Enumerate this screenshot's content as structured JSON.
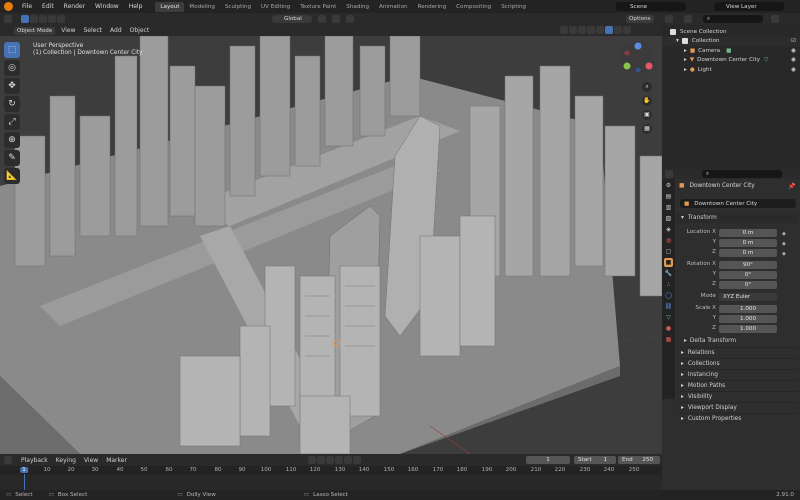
{
  "topbar": {
    "menus": [
      "File",
      "Edit",
      "Render",
      "Window",
      "Help"
    ],
    "workspaces": [
      "Layout",
      "Modeling",
      "Sculpting",
      "UV Editing",
      "Texture Paint",
      "Shading",
      "Animation",
      "Rendering",
      "Compositing",
      "Scripting"
    ],
    "active_workspace": "Layout",
    "scene": "Scene",
    "view_layer": "View Layer"
  },
  "viewport_header": {
    "mode": "Object Mode",
    "menus": [
      "View",
      "Select",
      "Add",
      "Object"
    ],
    "orientation": "Global",
    "options": "Options"
  },
  "viewport": {
    "title": "User Perspective",
    "subtitle": "(1) Collection | Downtown Center City"
  },
  "outliner": {
    "search_placeholder": "",
    "root": "Scene Collection",
    "collection": "Collection",
    "items": [
      {
        "name": "Camera",
        "icon": "camera-icon",
        "color": "#e09a52"
      },
      {
        "name": "Downtown Center City",
        "icon": "mesh-icon",
        "color": "#e09a52"
      },
      {
        "name": "Light",
        "icon": "light-icon",
        "color": "#e09a52"
      }
    ]
  },
  "properties": {
    "object_name": "Downtown Center City",
    "object_field": "Downtown Center City",
    "transform_label": "Transform",
    "location": {
      "label": "Location X",
      "x": "0 m",
      "y": "0 m",
      "z": "0 m"
    },
    "rotation": {
      "label": "Rotation X",
      "x": "90°",
      "y": "0°",
      "z": "0°"
    },
    "mode_label": "Mode",
    "mode_value": "XYZ Euler",
    "scale": {
      "label": "Scale X",
      "x": "1.000",
      "y": "1.000",
      "z": "1.000"
    },
    "axis_y": "Y",
    "axis_z": "Z",
    "delta_transform": "Delta Transform",
    "sections": [
      "Relations",
      "Collections",
      "Instancing",
      "Motion Paths",
      "Visibility",
      "Viewport Display",
      "Custom Properties"
    ]
  },
  "timeline": {
    "menus": [
      "Playback",
      "Keying",
      "View",
      "Marker"
    ],
    "current_frame": "1",
    "start_label": "Start",
    "start": "1",
    "end_label": "End",
    "end": "250",
    "ticks": [
      "1",
      "10",
      "20",
      "30",
      "40",
      "50",
      "60",
      "70",
      "80",
      "90",
      "100",
      "110",
      "120",
      "130",
      "140",
      "150",
      "160",
      "170",
      "180",
      "190",
      "200",
      "210",
      "220",
      "230",
      "240",
      "250"
    ]
  },
  "statusbar": {
    "select": "Select",
    "box_select": "Box Select",
    "dolly_view": "Dolly View",
    "lasso_select": "Lasso Select",
    "version": "2.91.0"
  },
  "colors": {
    "accent": "#4772b3",
    "object_orange": "#e09a52"
  }
}
